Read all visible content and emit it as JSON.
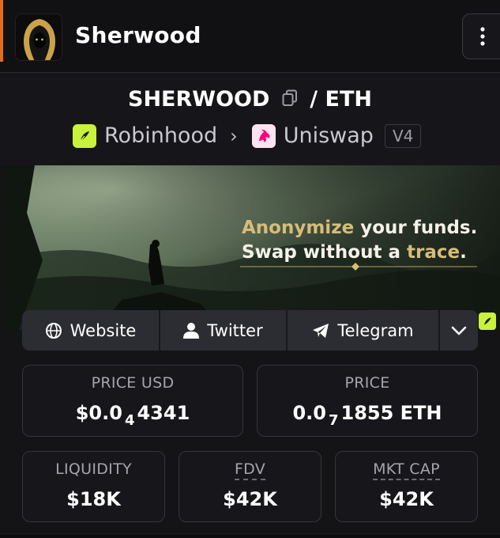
{
  "header": {
    "token_name": "Sherwood",
    "avatar_icon": "hooded-figure-logo",
    "menu_icon": "vertical-dots-icon",
    "accent": "#e36b1c"
  },
  "pair": {
    "base": "SHERWOOD",
    "separator": "/",
    "quote": "ETH",
    "copy_icon": "copy-icon"
  },
  "chain": {
    "network": "Robinhood",
    "dex": "Uniswap",
    "version": "V4",
    "network_color": "#c8f23c",
    "dex_color": "#ff007a"
  },
  "banner": {
    "tagline_line1_highlight": "Anonymize",
    "tagline_line1_rest": " your funds.",
    "tagline_line2_start": "Swap without a ",
    "tagline_line2_highlight": "trace",
    "tagline_line2_end": ".",
    "highlight_color": "#d6bd78"
  },
  "links": {
    "website": "Website",
    "twitter": "Twitter",
    "telegram": "Telegram"
  },
  "stats": {
    "price_usd": {
      "label": "PRICE USD",
      "prefix": "$0.0",
      "zeros": "4",
      "digits": "4341"
    },
    "price_eth": {
      "label": "PRICE",
      "prefix": "0.0",
      "zeros": "7",
      "digits": "1855 ETH"
    },
    "liquidity": {
      "label": "LIQUIDITY",
      "value": "$18K"
    },
    "fdv": {
      "label": "FDV",
      "value": "$42K"
    },
    "mkt_cap": {
      "label": "MKT CAP",
      "value": "$42K"
    }
  }
}
